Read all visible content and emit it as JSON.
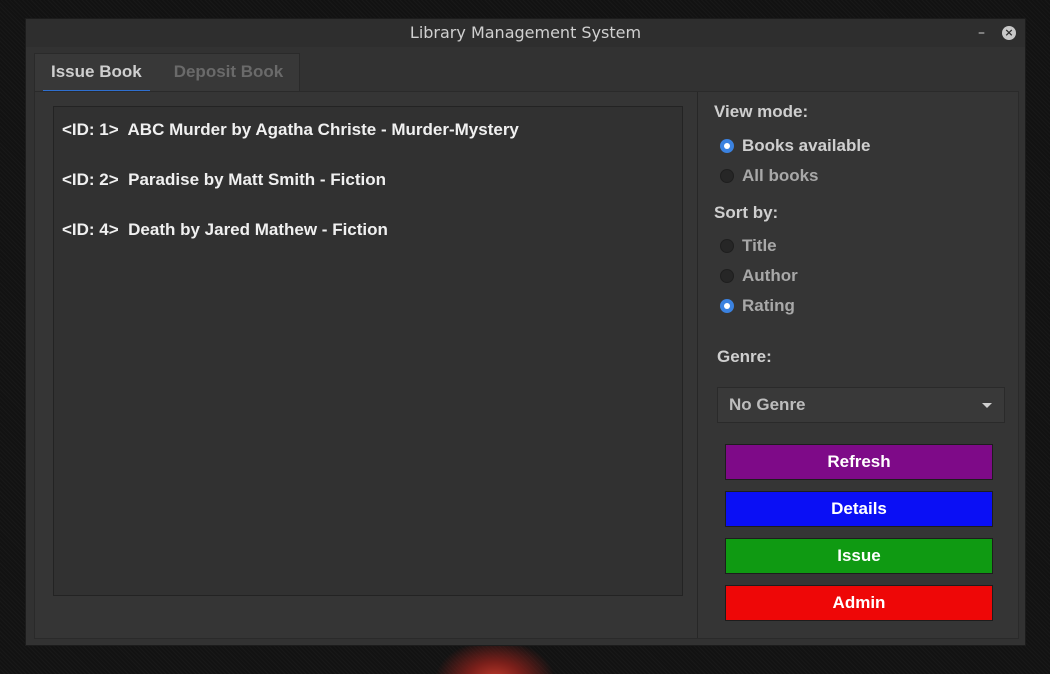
{
  "window": {
    "title": "Library Management System",
    "minimize_glyph": "–",
    "close_glyph": "×"
  },
  "tabs": [
    {
      "label": "Issue Book",
      "active": true
    },
    {
      "label": "Deposit Book",
      "active": false
    }
  ],
  "book_list": [
    "<ID: 1>  ABC Murder by Agatha Christe - Murder-Mystery",
    "<ID: 2>  Paradise by Matt Smith - Fiction",
    "<ID: 4>  Death by Jared Mathew - Fiction"
  ],
  "view_mode": {
    "label": "View mode:",
    "options": [
      {
        "label": "Books available",
        "checked": true
      },
      {
        "label": "All books",
        "checked": false
      }
    ]
  },
  "sort_by": {
    "label": "Sort by:",
    "options": [
      {
        "label": "Title",
        "checked": false
      },
      {
        "label": "Author",
        "checked": false
      },
      {
        "label": "Rating",
        "checked": true
      }
    ]
  },
  "genre": {
    "label": "Genre:",
    "selected": "No Genre"
  },
  "buttons": {
    "refresh": {
      "label": "Refresh",
      "color": "#7e0a88"
    },
    "details": {
      "label": "Details",
      "color": "#0a0ff5"
    },
    "issue": {
      "label": "Issue",
      "color": "#0f9a12"
    },
    "admin": {
      "label": "Admin",
      "color": "#ee0707"
    }
  },
  "colors": {
    "accent": "#2f6fcf",
    "window_bg": "#323232",
    "text": "#f0f0f0"
  }
}
